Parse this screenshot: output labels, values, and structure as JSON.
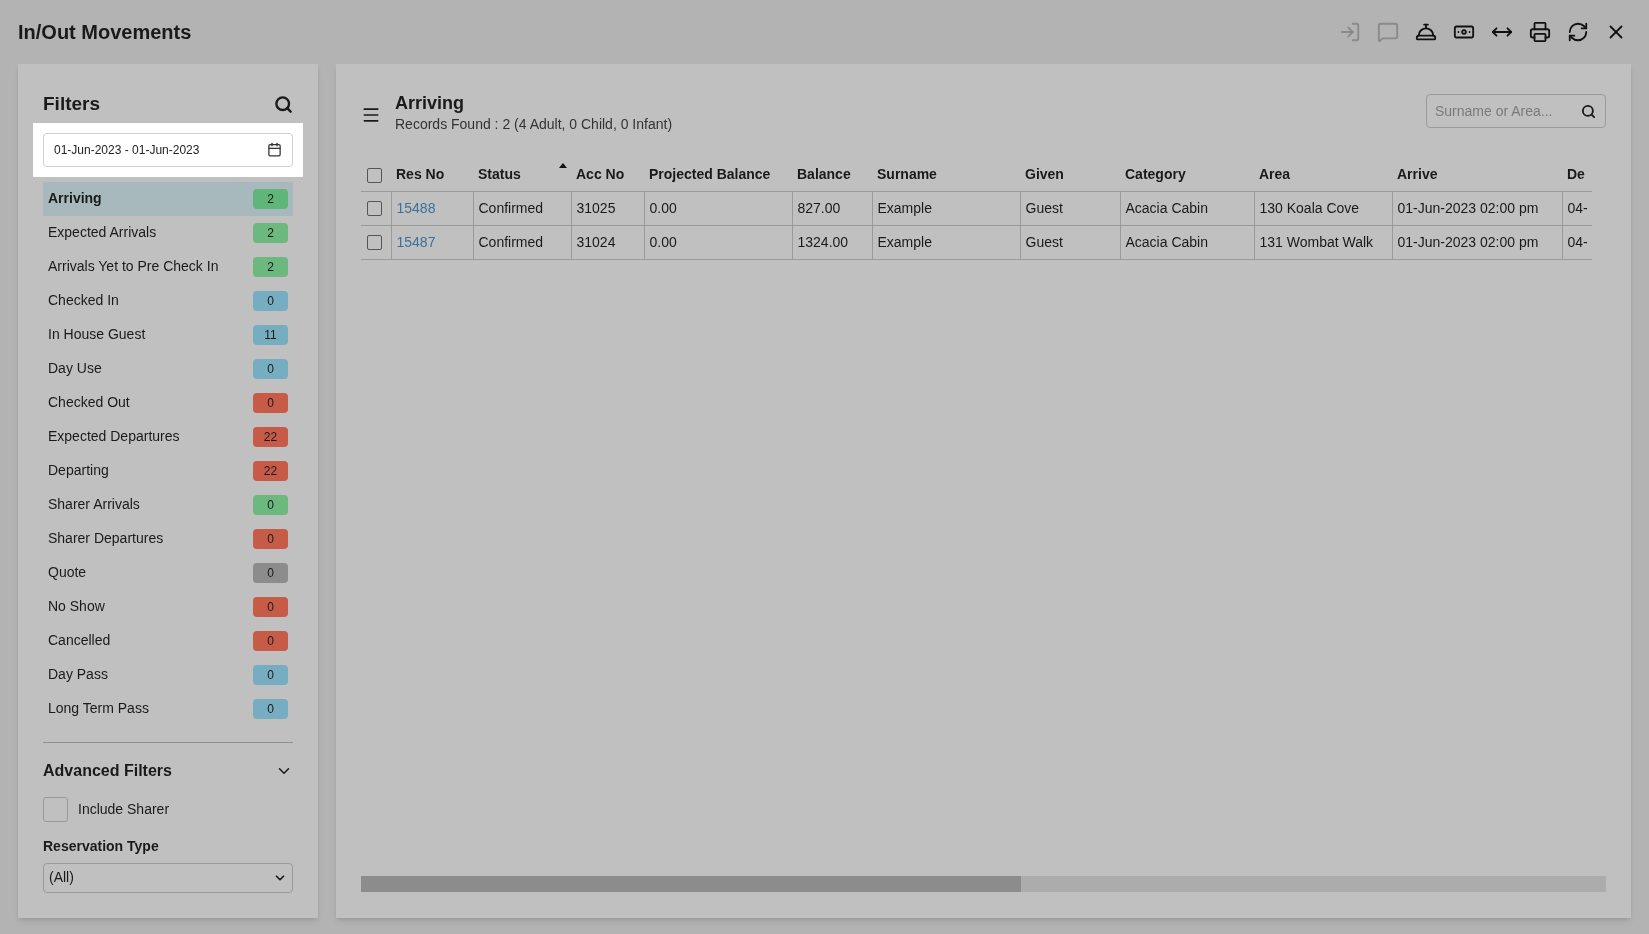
{
  "window": {
    "title": "In/Out Movements"
  },
  "toolbar": [
    {
      "kind": "login",
      "disabled": true
    },
    {
      "kind": "message",
      "disabled": true
    },
    {
      "kind": "bell",
      "disabled": false
    },
    {
      "kind": "money",
      "disabled": false
    },
    {
      "kind": "width",
      "disabled": false
    },
    {
      "kind": "print",
      "disabled": false
    },
    {
      "kind": "refresh",
      "disabled": false
    },
    {
      "kind": "close",
      "disabled": false
    }
  ],
  "filters": {
    "title": "Filters",
    "date_range": "01-Jun-2023 - 01-Jun-2023",
    "items": [
      {
        "label": "Arriving",
        "count": "2",
        "color": "#5fb57a",
        "selected": true
      },
      {
        "label": "Expected Arrivals",
        "count": "2",
        "color": "#6cb87e",
        "selected": false
      },
      {
        "label": "Arrivals Yet to Pre Check In",
        "count": "2",
        "color": "#6cb87e",
        "selected": false
      },
      {
        "label": "Checked In",
        "count": "0",
        "color": "#76adc1",
        "selected": false
      },
      {
        "label": "In House Guest",
        "count": "11",
        "color": "#76adc1",
        "selected": false
      },
      {
        "label": "Day Use",
        "count": "0",
        "color": "#76adc1",
        "selected": false
      },
      {
        "label": "Checked Out",
        "count": "0",
        "color": "#c65c48",
        "selected": false
      },
      {
        "label": "Expected Departures",
        "count": "22",
        "color": "#c65c48",
        "selected": false
      },
      {
        "label": "Departing",
        "count": "22",
        "color": "#c65c48",
        "selected": false
      },
      {
        "label": "Sharer Arrivals",
        "count": "0",
        "color": "#6cb87e",
        "selected": false
      },
      {
        "label": "Sharer Departures",
        "count": "0",
        "color": "#c65c48",
        "selected": false
      },
      {
        "label": "Quote",
        "count": "0",
        "color": "#8c8c8c",
        "selected": false
      },
      {
        "label": "No Show",
        "count": "0",
        "color": "#c65c48",
        "selected": false
      },
      {
        "label": "Cancelled",
        "count": "0",
        "color": "#c65c48",
        "selected": false
      },
      {
        "label": "Day Pass",
        "count": "0",
        "color": "#76adc1",
        "selected": false
      },
      {
        "label": "Long Term Pass",
        "count": "0",
        "color": "#76adc1",
        "selected": false
      }
    ],
    "advanced": {
      "title": "Advanced Filters",
      "expanded": true,
      "include_sharer": {
        "label": "Include Sharer",
        "checked": false
      },
      "reservation_type": {
        "label": "Reservation Type",
        "value": "(All)"
      }
    }
  },
  "main": {
    "title": "Arriving",
    "subtitle": "Records Found : 2 (4 Adult, 0 Child, 0 Infant)",
    "search": {
      "placeholder": "Surname or Area..."
    },
    "table": {
      "all_checked": false,
      "columns": [
        {
          "label": "Res No",
          "sorted": false
        },
        {
          "label": "Status",
          "sorted": true
        },
        {
          "label": "Acc No",
          "sorted": false
        },
        {
          "label": "Projected Balance",
          "sorted": false
        },
        {
          "label": "Balance",
          "sorted": false
        },
        {
          "label": "Surname",
          "sorted": false
        },
        {
          "label": "Given",
          "sorted": false
        },
        {
          "label": "Category",
          "sorted": false
        },
        {
          "label": "Area",
          "sorted": false
        },
        {
          "label": "Arrive",
          "sorted": false
        },
        {
          "label": "De",
          "sorted": false
        }
      ],
      "rows": [
        {
          "checked": false,
          "cells": [
            "15488",
            "Confirmed",
            "31025",
            "0.00",
            "827.00",
            "Example",
            "Guest",
            "Acacia Cabin",
            "130 Koala Cove",
            "01-Jun-2023 02:00 pm",
            "04-"
          ]
        },
        {
          "checked": false,
          "cells": [
            "15487",
            "Confirmed",
            "31024",
            "0.00",
            "1324.00",
            "Example",
            "Guest",
            "Acacia Cabin",
            "131 Wombat Walk",
            "01-Jun-2023 02:00 pm",
            "04-"
          ]
        }
      ]
    }
  }
}
